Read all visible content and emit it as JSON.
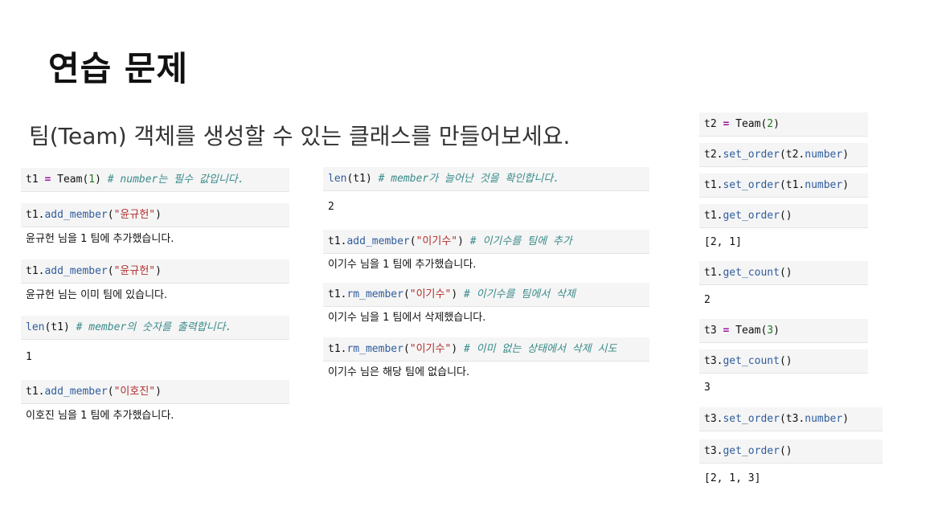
{
  "title": "연습 문제",
  "subtitle": "팀(Team) 객체를 생성할 수 있는 클래스를 만들어보세요.",
  "left": {
    "c1": {
      "a": "t1",
      "op": "=",
      "b": "Team(",
      "n": "1",
      "c": ")",
      "cm": "# number는 필수 값입니다."
    },
    "c2": {
      "a": "t1.",
      "fn": "add_member",
      "p": "(",
      "s": "\"윤규헌\"",
      "q": ")"
    },
    "o2": "윤규헌 님을 1 팀에 추가했습니다.",
    "c3": {
      "a": "t1.",
      "fn": "add_member",
      "p": "(",
      "s": "\"윤규헌\"",
      "q": ")"
    },
    "o3": "윤규헌 님는 이미 팀에 있습니다.",
    "c4": {
      "fn": "len",
      "a": "(t1)",
      "cm": "# member의 숫자를 출력합니다."
    },
    "o4": "1",
    "c5": {
      "a": "t1.",
      "fn": "add_member",
      "p": "(",
      "s": "\"이호진\"",
      "q": ")"
    },
    "o5": "이호진 님을 1 팀에 추가했습니다."
  },
  "middle": {
    "c1": {
      "fn": "len",
      "a": "(t1)",
      "cm": "# member가 늘어난 것을 확인합니다."
    },
    "o1": "2",
    "c2": {
      "a": "t1.",
      "fn": "add_member",
      "p": "(",
      "s": "\"이기수\"",
      "q": ")",
      "cm": "# 이기수를 팀에 추가"
    },
    "o2": "이기수 님을 1 팀에 추가했습니다.",
    "c3": {
      "a": "t1.",
      "fn": "rm_member",
      "p": "(",
      "s": "\"이기수\"",
      "q": ")",
      "cm": "# 이기수를 팀에서 삭제"
    },
    "o3": "이기수 님을 1 팀에서 삭제했습니다.",
    "c4": {
      "a": "t1.",
      "fn": "rm_member",
      "p": "(",
      "s": "\"이기수\"",
      "q": ")",
      "cm": "# 이미 없는 상태에서 삭제 시도"
    },
    "o4": "이기수 님은 해당 팀에 없습니다."
  },
  "right": {
    "c1": {
      "a": "t2",
      "op": "=",
      "b": "Team(",
      "n": "2",
      "c": ")"
    },
    "c2": {
      "a": "t2.",
      "fn": "set_order",
      "p": "(t2.",
      "f2": "number",
      "q": ")"
    },
    "c3": {
      "a": "t1.",
      "fn": "set_order",
      "p": "(t1.",
      "f2": "number",
      "q": ")"
    },
    "c4": {
      "a": "t1.",
      "fn": "get_order",
      "p": "()"
    },
    "o4": "[2, 1]",
    "c5": {
      "a": "t1.",
      "fn": "get_count",
      "p": "()"
    },
    "o5": "2",
    "c6": {
      "a": "t3",
      "op": "=",
      "b": "Team(",
      "n": "3",
      "c": ")"
    },
    "c7": {
      "a": "t3.",
      "fn": "get_count",
      "p": "()"
    },
    "o7": "3",
    "c8": {
      "a": "t3.",
      "fn": "set_order",
      "p": "(t3.",
      "f2": "number",
      "q": ")"
    },
    "c9": {
      "a": "t3.",
      "fn": "get_order",
      "p": "()"
    },
    "o9": "[2, 1, 3]"
  }
}
